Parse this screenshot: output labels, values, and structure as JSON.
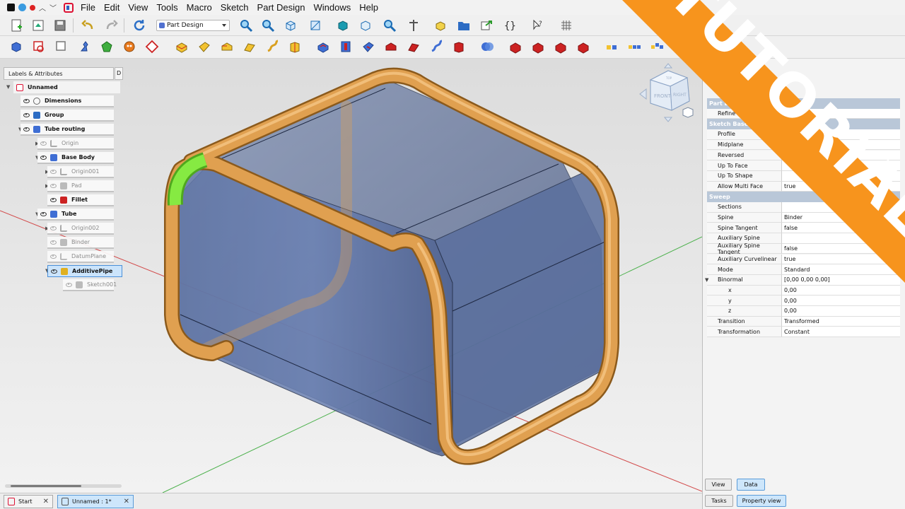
{
  "menubar": {
    "items": [
      "File",
      "Edit",
      "View",
      "Tools",
      "Macro",
      "Sketch",
      "Part Design",
      "Windows",
      "Help"
    ]
  },
  "toolbar": {
    "workbench": "Part Design"
  },
  "tree": {
    "header": "Labels & Attributes",
    "header_d": "D",
    "root": "Unnamed",
    "rows": [
      {
        "label": "Dimensions",
        "dim": false
      },
      {
        "label": "Group",
        "dim": false
      },
      {
        "label": "Tube routing",
        "dim": false
      },
      {
        "label": "Origin",
        "dim": true
      },
      {
        "label": "Base Body",
        "dim": false
      },
      {
        "label": "Origin001",
        "dim": true
      },
      {
        "label": "Pad",
        "dim": true
      },
      {
        "label": "Fillet",
        "dim": false
      },
      {
        "label": "Tube",
        "dim": false
      },
      {
        "label": "Origin002",
        "dim": true
      },
      {
        "label": "Binder",
        "dim": true
      },
      {
        "label": "DatumPlane",
        "dim": true
      },
      {
        "label": "AdditivePipe",
        "dim": false
      },
      {
        "label": "Sketch001",
        "dim": true
      }
    ]
  },
  "properties": {
    "group1": "Part D",
    "refine": "Refine",
    "group2": "Sketch Based",
    "group3": "Sweep",
    "rows_a": [
      {
        "name": "Profile",
        "value": ""
      },
      {
        "name": "Midplane",
        "value": ""
      },
      {
        "name": "Reversed",
        "value": ""
      },
      {
        "name": "Up To Face",
        "value": ""
      },
      {
        "name": "Up To Shape",
        "value": ""
      },
      {
        "name": "Allow Multi Face",
        "value": "true"
      }
    ],
    "rows_b": [
      {
        "name": "Sections",
        "value": ""
      },
      {
        "name": "Spine",
        "value": "Binder"
      },
      {
        "name": "Spine Tangent",
        "value": "false"
      },
      {
        "name": "Auxiliary Spine",
        "value": ""
      },
      {
        "name": "Auxiliary Spine Tangent",
        "value": "false"
      },
      {
        "name": "Auxiliary Curvelinear",
        "value": "true"
      },
      {
        "name": "Mode",
        "value": "Standard"
      },
      {
        "name": "Binormal",
        "value": "[0,00 0,00 0,00]"
      },
      {
        "name": "x",
        "value": "0,00"
      },
      {
        "name": "y",
        "value": "0,00"
      },
      {
        "name": "z",
        "value": "0,00"
      },
      {
        "name": "Transition",
        "value": "Transformed"
      },
      {
        "name": "Transformation",
        "value": "Constant"
      }
    ],
    "tab_view": "View",
    "tab_data": "Data",
    "tab_tasks": "Tasks",
    "tab_property_view": "Property view"
  },
  "navcube": {
    "front": "FRONT",
    "right": "RIGHT",
    "top": "TOP"
  },
  "doc_tabs": {
    "start": "Start",
    "unnamed": "Unnamed : 1*",
    "close": "✕"
  },
  "banner": {
    "text": "TUTORIAL",
    "color": "#f7941d"
  },
  "colors": {
    "tube": "#e0a050",
    "highlight": "#7ee03a",
    "body": "#5a6f9a"
  }
}
